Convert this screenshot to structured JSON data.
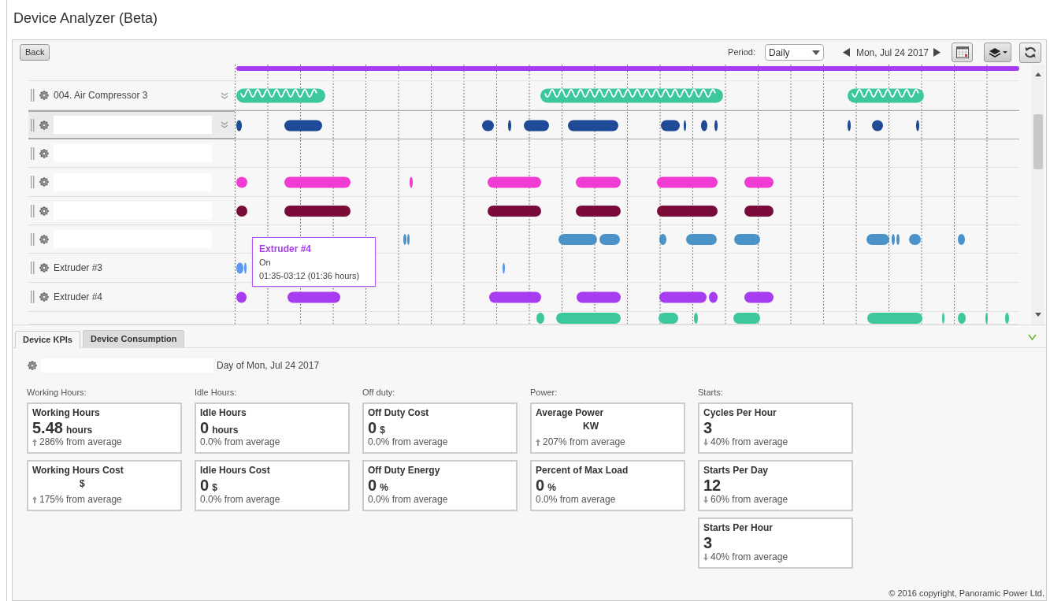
{
  "page_title": "Device Analyzer (Beta)",
  "toolbar": {
    "back": "Back",
    "period_label": "Period:",
    "period": "Daily",
    "date": "Mon, Jul 24 2017"
  },
  "devices": [
    {
      "selected": false,
      "expander": false,
      "kind": "pill",
      "color": "#a83cf5"
    },
    {
      "label": "004. Air Compressor 3",
      "selected": false,
      "expander": true,
      "kind": "wave",
      "color": "#3cc89c"
    },
    {
      "selected": true,
      "expander": true,
      "kind": "pill",
      "color": "#1f4b96"
    },
    {
      "selected": false,
      "expander": false,
      "kind": "none"
    },
    {
      "selected": false,
      "expander": false,
      "kind": "pill",
      "color": "#f03cd2"
    },
    {
      "selected": false,
      "expander": false,
      "kind": "pill",
      "color": "#7a0c3a"
    },
    {
      "selected": false,
      "expander": false,
      "kind": "pill",
      "color": "#4b92c8"
    },
    {
      "label": "Extruder #3",
      "selected": false,
      "expander": false,
      "kind": "pill",
      "color": "#5b98f2"
    },
    {
      "label": "Extruder #4",
      "selected": false,
      "expander": false,
      "kind": "pill",
      "color": "#a83cf0"
    },
    {
      "selected": false,
      "expander": false,
      "kind": "pill",
      "color": "#3cc89c"
    }
  ],
  "tooltip": {
    "title": "Extruder #4",
    "state": "On",
    "time": "01:35-03:12 (01:36 hours)"
  },
  "tabs": [
    {
      "label": "Device KPIs",
      "selected": true
    },
    {
      "label": "Device Consumption",
      "selected": false
    }
  ],
  "kpi_header": {
    "date_text": "Day of Mon, Jul 24 2017"
  },
  "kpi_groups": [
    {
      "label": "Working Hours:",
      "cards": [
        {
          "title": "Working Hours",
          "value": "5.48",
          "unit": "hours",
          "kind": "rising",
          "change": "286% from average"
        },
        {
          "title": "Working Hours Cost",
          "unit": "$",
          "kind": "rising",
          "change": "175% from average"
        }
      ]
    },
    {
      "label": "Idle Hours:",
      "cards": [
        {
          "title": "Idle Hours",
          "value": "0",
          "unit": "hours",
          "kind": "flat",
          "change": "0.0% from average"
        },
        {
          "title": "Idle Hours Cost",
          "value": "0",
          "unit": "$",
          "kind": "flat",
          "change": "0.0% from average"
        }
      ]
    },
    {
      "label": "Off duty:",
      "cards": [
        {
          "title": "Off Duty Cost",
          "value": "0",
          "unit": "$",
          "kind": "flat",
          "change": "0.0% from average"
        },
        {
          "title": "Off Duty Energy",
          "value": "0",
          "unit": "%",
          "kind": "flat",
          "change": "0.0% from average"
        }
      ]
    },
    {
      "label": "Power:",
      "cards": [
        {
          "title": "Average Power",
          "unit": "KW",
          "kind": "rising",
          "change": "207% from average"
        },
        {
          "title": "Percent of Max Load",
          "value": "0",
          "unit": "%",
          "kind": "flat",
          "change": "0.0% from average"
        }
      ]
    },
    {
      "label": "Starts:",
      "cards": [
        {
          "title": "Cycles Per Hour",
          "value": "3",
          "kind": "falling",
          "change": "40% from average"
        },
        {
          "title": "Starts Per Day",
          "value": "12",
          "kind": "falling",
          "change": "60% from average"
        },
        {
          "title": "Starts Per Hour",
          "value": "3",
          "kind": "falling",
          "change": "40% from average"
        }
      ]
    }
  ],
  "footer": "© 2016 copyright, Panoramic Power Ltd."
}
